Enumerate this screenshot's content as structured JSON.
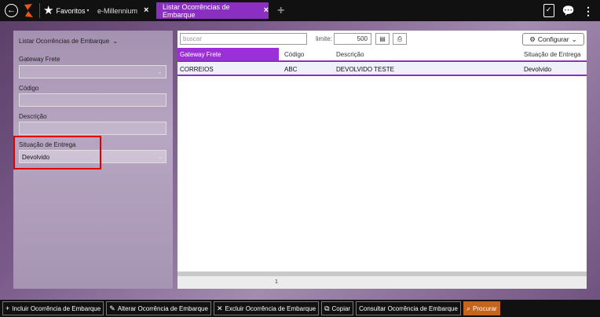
{
  "topbar": {
    "favorites_label": "Favoritos",
    "tabs": [
      {
        "label": "e-Millennium",
        "active": false
      },
      {
        "label": "Listar Ocorrências de Embarque",
        "active": true
      }
    ],
    "accent_color": "#8a2fc2"
  },
  "filters": {
    "title": "Listar Ocorrências de Embarque",
    "fields": [
      {
        "label": "Gateway Frete",
        "value": "",
        "type": "select"
      },
      {
        "label": "Código",
        "value": "",
        "type": "text"
      },
      {
        "label": "Descrição",
        "value": "",
        "type": "text"
      },
      {
        "label": "Situação de Entrega",
        "value": "Devolvido",
        "type": "select",
        "highlighted": true
      }
    ]
  },
  "grid": {
    "search_placeholder": "buscar",
    "limit_label": "limite:",
    "limit_value": "500",
    "config_label": "Configurar",
    "columns": [
      "Gateway Frete",
      "Código",
      "Descrição",
      "Situação de Entrega"
    ],
    "rows": [
      [
        "CORREIOS",
        "ABC",
        "DEVOLVIDO TESTE",
        "Devolvido"
      ]
    ],
    "page": "1"
  },
  "actions": [
    {
      "label": "Incluir Ocorrência de Embarque",
      "icon": "plus-icon",
      "glyph": "+"
    },
    {
      "label": "Alterar Ocorrência de Embarque",
      "icon": "edit-icon",
      "glyph": "✎"
    },
    {
      "label": "Excluir Ocorrência de Embarque",
      "icon": "delete-icon",
      "glyph": "✕"
    },
    {
      "label": "Copiar",
      "icon": "copy-icon",
      "glyph": "⧉"
    },
    {
      "label": "Consultar Ocorrência de Embarque",
      "icon": "",
      "glyph": ""
    },
    {
      "label": "Procurar",
      "icon": "search-icon",
      "glyph": "⌕",
      "primary": true
    }
  ]
}
